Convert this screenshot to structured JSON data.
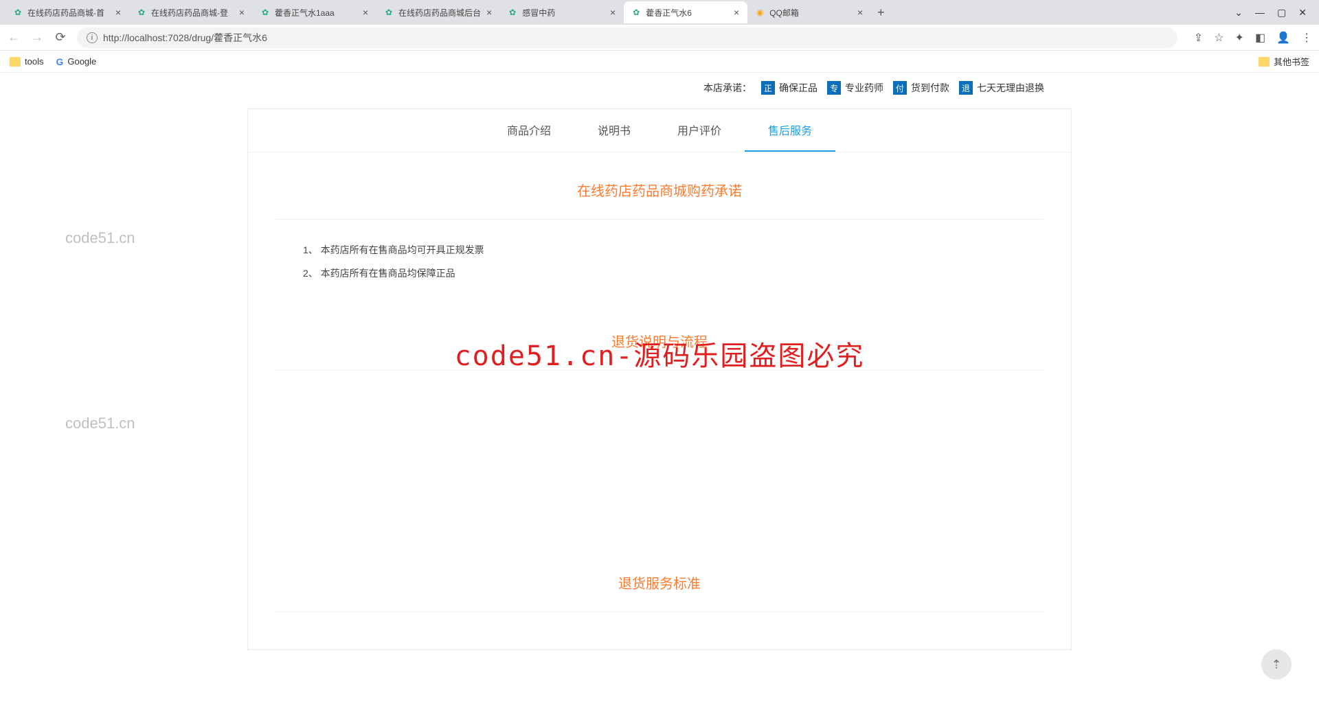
{
  "browser": {
    "tabs": [
      {
        "title": "在线药店药品商城-首",
        "favicon": "green"
      },
      {
        "title": "在线药店药品商城-登",
        "favicon": "green"
      },
      {
        "title": "藿香正气水1aaa",
        "favicon": "green"
      },
      {
        "title": "在线药店药品商城后台",
        "favicon": "green"
      },
      {
        "title": "感冒中药",
        "favicon": "green"
      },
      {
        "title": "藿香正气水6",
        "favicon": "green",
        "active": true
      },
      {
        "title": "QQ邮箱",
        "favicon": "orange"
      }
    ],
    "url": "http://localhost:7028/drug/藿香正气水6",
    "bookmarks": {
      "tools": "tools",
      "google": "Google",
      "other": "其他书签"
    }
  },
  "promise": {
    "label": "本店承诺：",
    "items": [
      {
        "badge": "正",
        "text": "确保正品"
      },
      {
        "badge": "专",
        "text": "专业药师"
      },
      {
        "badge": "付",
        "text": "货到付款"
      },
      {
        "badge": "退",
        "text": "七天无理由退换"
      }
    ]
  },
  "detail_tabs": {
    "items": [
      "商品介绍",
      "说明书",
      "用户评价",
      "售后服务"
    ],
    "active_index": 3
  },
  "sections": {
    "s1": {
      "title": "在线药店药品商城购药承诺",
      "list": [
        "1、 本药店所有在售商品均可开具正规发票",
        "2、 本药店所有在售商品均保障正品"
      ]
    },
    "s2": {
      "title": "退货说明与流程"
    },
    "s3": {
      "title": "退货服务标准"
    }
  },
  "watermark": {
    "small": "code51.cn",
    "big": "code51.cn-源码乐园盗图必究"
  }
}
